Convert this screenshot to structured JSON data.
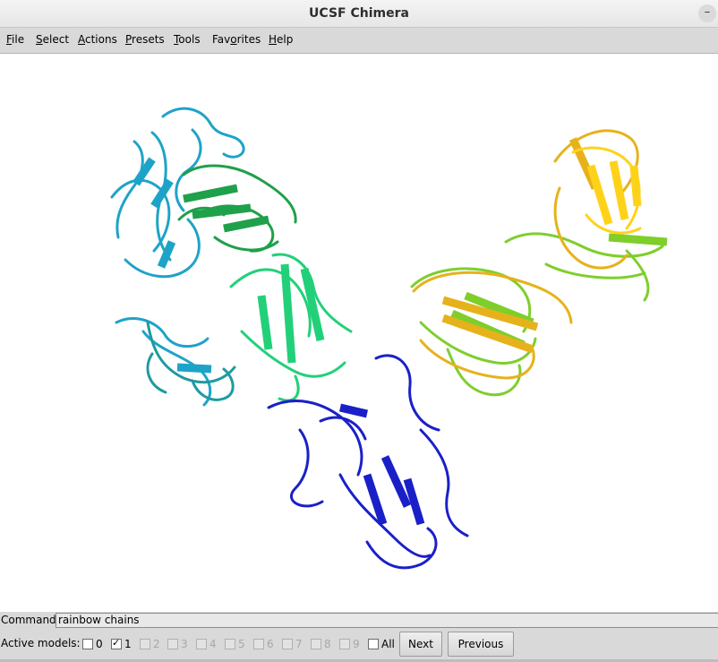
{
  "window": {
    "title": "UCSF Chimera",
    "minimize_glyph": "–"
  },
  "menu": [
    {
      "underline": "F",
      "rest": "ile"
    },
    {
      "underline": "S",
      "rest": "elect"
    },
    {
      "underline": "A",
      "rest": "ctions"
    },
    {
      "underline": "P",
      "rest": "resets"
    },
    {
      "underline": "T",
      "rest": "ools"
    },
    {
      "pre": "Fav",
      "underline": "o",
      "rest": "rites"
    },
    {
      "underline": "H",
      "rest": "elp"
    }
  ],
  "viewer": {
    "background": "#ffffff",
    "chain_colors": {
      "cyan": "#1ea3c8",
      "teal": "#1f9aa0",
      "green": "#1fa04a",
      "mint": "#22d07a",
      "blue": "#1a20c8",
      "lime": "#7fce2c",
      "gold": "#e6b21c",
      "yellow": "#ffd21a"
    }
  },
  "command": {
    "label": "Command:",
    "value": "rainbow chains"
  },
  "active_models": {
    "label": "Active models:",
    "checkboxes": [
      {
        "label": "0",
        "checked": false,
        "enabled": true
      },
      {
        "label": "1",
        "checked": true,
        "enabled": true
      },
      {
        "label": "2",
        "checked": false,
        "enabled": false
      },
      {
        "label": "3",
        "checked": false,
        "enabled": false
      },
      {
        "label": "4",
        "checked": false,
        "enabled": false
      },
      {
        "label": "5",
        "checked": false,
        "enabled": false
      },
      {
        "label": "6",
        "checked": false,
        "enabled": false
      },
      {
        "label": "7",
        "checked": false,
        "enabled": false
      },
      {
        "label": "8",
        "checked": false,
        "enabled": false
      },
      {
        "label": "9",
        "checked": false,
        "enabled": false
      },
      {
        "label": "All",
        "checked": false,
        "enabled": true
      }
    ],
    "next_label": "Next",
    "previous_label": "Previous"
  }
}
